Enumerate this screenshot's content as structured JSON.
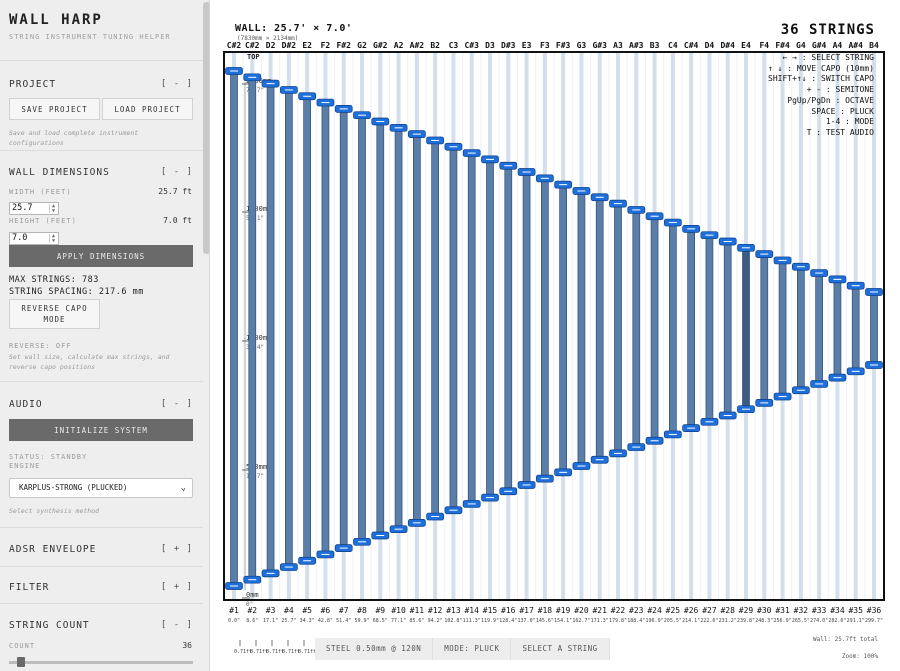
{
  "app": {
    "title": "WALL HARP",
    "subtitle": "STRING INSTRUMENT TUNING HELPER"
  },
  "project": {
    "heading": "PROJECT",
    "toggle": "[ - ]",
    "save_label": "SAVE PROJECT",
    "load_label": "LOAD PROJECT",
    "hint": "Save and load complete instrument configurations"
  },
  "wall": {
    "heading": "WALL DIMENSIONS",
    "toggle": "[ - ]",
    "width_label": "WIDTH (FEET)",
    "width_display": "25.7 ft",
    "width_value": "25.7",
    "height_label": "HEIGHT (FEET)",
    "height_display": "7.0 ft",
    "height_value": "7.0",
    "apply_label": "APPLY DIMENSIONS",
    "max_strings": "MAX STRINGS: 783",
    "spacing": "STRING SPACING: 217.6 mm",
    "reverse_button": "REVERSE CAPO MODE",
    "reverse_status": "REVERSE: OFF",
    "hint": "Set wall size, calculate max strings, and reverse capo positions"
  },
  "audio": {
    "heading": "AUDIO",
    "toggle": "[ - ]",
    "init_label": "INITIALIZE SYSTEM",
    "status": "STATUS: STANDBY",
    "engine_label": "ENGINE",
    "engine_selected": "KARPLUS-STRONG (PLUCKED)",
    "hint": "Select synthesis method"
  },
  "adsr": {
    "heading": "ADSR ENVELOPE",
    "toggle": "[ + ]"
  },
  "filter": {
    "heading": "FILTER",
    "toggle": "[ + ]"
  },
  "string_count": {
    "heading": "STRING COUNT",
    "toggle": "[ - ]",
    "count_label": "COUNT",
    "count_value": "36",
    "slider_fraction": 0.045
  },
  "canvas": {
    "wall_title": "WALL: 25.7' × 7.0'",
    "wall_mm": "(7830mm × 2134mm)",
    "string_count_label": "36 STRINGS",
    "help_lines": [
      "← → : SELECT STRING",
      "↑ ↓ : MOVE CAPO (10mm)",
      "SHIFT+↑↓ : SWITCH CAPO",
      "+ - : SEMITONE",
      "PgUp/PgDn : OCTAVE",
      "SPACE : PLUCK",
      "1-4 : MODE",
      "T : TEST AUDIO"
    ],
    "notes": [
      "C#2",
      "C#2",
      "D2",
      "D#2",
      "E2",
      "F2",
      "F#2",
      "G2",
      "G#2",
      "A2",
      "A#2",
      "B2",
      "C3",
      "C#3",
      "D3",
      "D#3",
      "E3",
      "F3",
      "F#3",
      "G3",
      "G#3",
      "A3",
      "A#3",
      "B3",
      "C4",
      "C#4",
      "D4",
      "D#4",
      "E4",
      "F4",
      "F#4",
      "G4",
      "G#4",
      "A4",
      "A#4",
      "B4"
    ],
    "string_labels": [
      "#1",
      "#2",
      "#3",
      "#4",
      "#5",
      "#6",
      "#7",
      "#8",
      "#9",
      "#10",
      "#11",
      "#12",
      "#13",
      "#14",
      "#15",
      "#16",
      "#17",
      "#18",
      "#19",
      "#20",
      "#21",
      "#22",
      "#23",
      "#24",
      "#25",
      "#26",
      "#27",
      "#28",
      "#29",
      "#30",
      "#31",
      "#32",
      "#33",
      "#34",
      "#35",
      "#36"
    ],
    "position_labels": [
      "0.0\"",
      "8.6\"",
      "17.1\"",
      "25.7\"",
      "34.3\"",
      "42.8\"",
      "51.4\"",
      "59.9\"",
      "68.5\"",
      "77.1\"",
      "85.6\"",
      "94.2\"",
      "102.8\"",
      "111.3\"",
      "119.9\"",
      "128.4\"",
      "137.0\"",
      "145.6\"",
      "154.1\"",
      "162.7\"",
      "171.3\"",
      "179.8\"",
      "188.4\"",
      "196.9\"",
      "205.5\"",
      "214.1\"",
      "222.6\"",
      "231.2\"",
      "239.8\"",
      "248.3\"",
      "256.9\"",
      "265.5\"",
      "274.0\"",
      "282.6\"",
      "291.1\"",
      "299.7\""
    ],
    "top_label": "TOP",
    "y_markers": [
      {
        "mm": "2000mm",
        "inch": "78.7\""
      },
      {
        "mm": "1500mm",
        "inch": "59.1\""
      },
      {
        "mm": "1000mm",
        "inch": "39.4\""
      },
      {
        "mm": "500mm",
        "inch": "19.7\""
      },
      {
        "mm": "0mm",
        "inch": "0\""
      }
    ],
    "bottom_scale_labels": [
      "0.71ft",
      "0.71ft",
      "0.71ft",
      "0.71ft",
      "0.71ft"
    ],
    "status_pills": [
      "STEEL 0.50mm @ 120N",
      "MODE: PLUCK",
      "SELECT A STRING"
    ],
    "wall_total": "Wall: 25.7ft total",
    "zoom": "Zoom: 100%",
    "selected_string": 29,
    "colors": {
      "string": "#5b7ea8",
      "string_selected": "#3d5a80",
      "capo": "#1e6fd9",
      "grid": "#d5dfeb",
      "frame": "#111111"
    }
  }
}
